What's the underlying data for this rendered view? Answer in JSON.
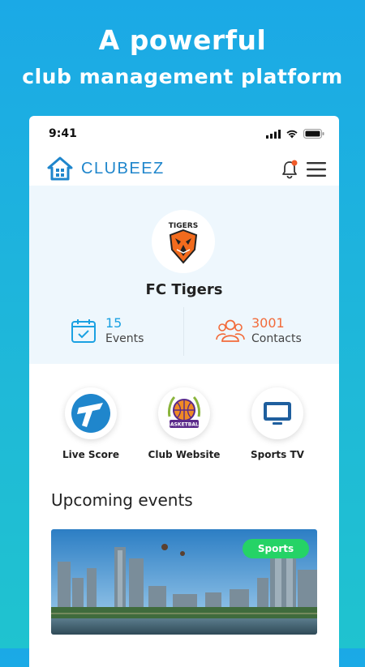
{
  "promo": {
    "line1": "A powerful",
    "line2": "club management platform"
  },
  "status_bar": {
    "time": "9:41",
    "icons": [
      "signal-icon",
      "wifi-icon",
      "battery-icon"
    ]
  },
  "header": {
    "logo_icon": "house-logo-icon",
    "app_name": "CLUBEEZ",
    "notification_icon": "bell-icon",
    "menu_icon": "hamburger-menu-icon",
    "colors": {
      "brand": "#1f86cc",
      "notification_dot": "#f05a28"
    }
  },
  "club": {
    "name": "FC Tigers",
    "logo_text": "TIGERS",
    "stats": [
      {
        "value": "15",
        "label": "Events",
        "icon": "calendar-check-icon",
        "color": "#1ba1e2"
      },
      {
        "value": "3001",
        "label": "Contacts",
        "icon": "users-icon",
        "color": "#f26b3a"
      }
    ]
  },
  "shortcuts": [
    {
      "label": "Live Score",
      "icon": "live-score-icon"
    },
    {
      "label": "Club Website",
      "icon": "basketball-badge-icon",
      "badge_text": "BASKETBALL"
    },
    {
      "label": "Sports TV",
      "icon": "tv-icon"
    }
  ],
  "upcoming": {
    "title": "Upcoming events",
    "events": [
      {
        "category": "Sports",
        "image": "city-skyline-image"
      }
    ]
  }
}
